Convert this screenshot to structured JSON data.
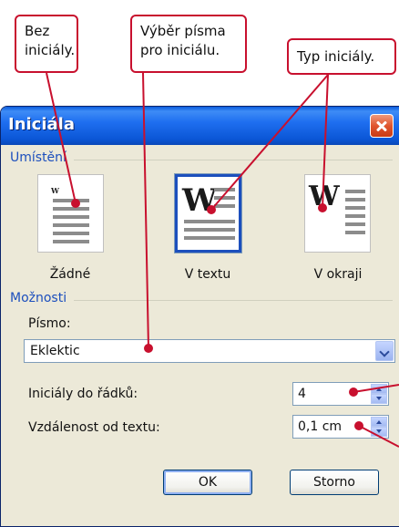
{
  "callouts": {
    "no_initials": "Bez\niniciály.",
    "font_choice": "Výběr písma\npro iniciálu.",
    "initial_type": "Typ iniciály."
  },
  "dialog": {
    "title": "Iniciála",
    "placement_group": "Umístění",
    "options_group": "Možnosti",
    "placements": [
      {
        "label": "Žádné",
        "icon": "no-drop-cap-icon"
      },
      {
        "label": "V textu",
        "icon": "dropped-initial-icon",
        "selected": true
      },
      {
        "label": "V okraji",
        "icon": "in-margin-initial-icon"
      }
    ],
    "font": {
      "label": "Písmo:",
      "value": "Eklektic"
    },
    "lines_to_drop": {
      "label": "Iniciály do řádků:",
      "value": "4"
    },
    "distance_from_text": {
      "label": "Vzdálenost od textu:",
      "value": "0,1 cm"
    },
    "ok_label": "OK",
    "cancel_label": "Storno"
  },
  "colors": {
    "callout_border": "#c8102e",
    "titlebar": "#1f6ff0",
    "group_label": "#1c4fbd",
    "dialog_bg": "#ece9d8"
  }
}
